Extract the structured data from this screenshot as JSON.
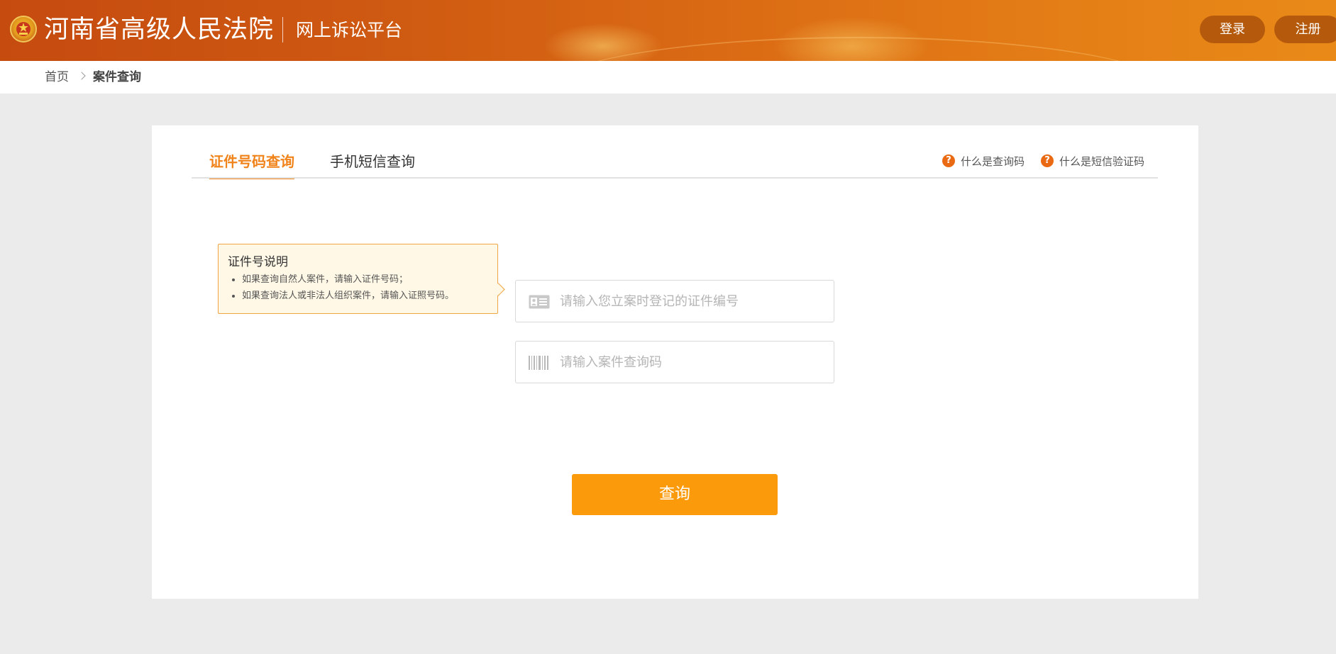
{
  "header": {
    "site_title": "河南省高级人民法院",
    "platform_title": "网上诉讼平台",
    "login_label": "登录",
    "register_label": "注册"
  },
  "breadcrumb": {
    "home": "首页",
    "current": "案件查询"
  },
  "tabs": [
    {
      "label": "证件号码查询",
      "active": true
    },
    {
      "label": "手机短信查询",
      "active": false
    }
  ],
  "help_links": [
    {
      "label": "什么是查询码"
    },
    {
      "label": "什么是短信验证码"
    }
  ],
  "tip": {
    "title": "证件号说明",
    "items": [
      "如果查询自然人案件，请输入证件号码；",
      "如果查询法人或非法人组织案件，请输入证照号码。"
    ]
  },
  "form": {
    "id_number": {
      "placeholder": "请输入您立案时登记的证件编号",
      "value": "",
      "icon": "id-card-icon"
    },
    "query_code": {
      "placeholder": "请输入案件查询码",
      "value": "",
      "icon": "barcode-icon"
    },
    "submit_label": "查询"
  },
  "colors": {
    "header_start": "#c54b0f",
    "header_end": "#e98a18",
    "accent": "#f0831a",
    "button": "#fb9a0b",
    "tip_bg": "#fff8e6",
    "tip_border": "#f1a544"
  }
}
